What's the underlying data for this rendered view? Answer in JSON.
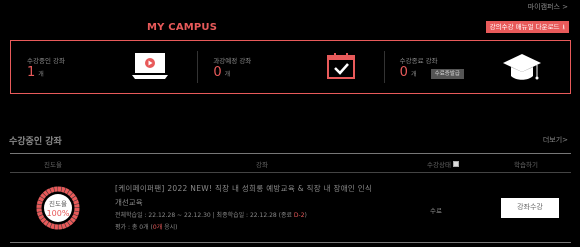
{
  "breadcrumb": "마이캠퍼스 >",
  "page_title": "MY CAMPUS",
  "manual_button": "강의수강 매뉴얼 다운로드",
  "colors": {
    "accent": "#e85a5a",
    "background": "#000000"
  },
  "stats": [
    {
      "label": "수강중인 강좌",
      "value": "1",
      "unit": "개",
      "icon": "laptop-play-icon"
    },
    {
      "label": "과강예정 강좌",
      "value": "0",
      "unit": "개",
      "icon": "calendar-check-icon"
    },
    {
      "label": "수강종료 강좌",
      "value": "0",
      "unit": "개",
      "button": "수료증발급",
      "icon": "graduation-cap-icon"
    }
  ],
  "section": {
    "title": "수강중인 강좌",
    "more": "더보기>"
  },
  "table": {
    "headers": {
      "progress": "진도율",
      "course": "강좌",
      "review": "수강상태",
      "study": "학습하기"
    },
    "rows": [
      {
        "progress_label": "진도율",
        "progress_pct": "100%",
        "progress_value": 1.0,
        "title": "[케이페이퍼팬] 2022 NEW! 직장 내 성희롱 예방교육 & 직장 내 장애인 인식",
        "subtitle": "개선교육",
        "period_prefix": "전체학습일 : 22.12.28 ~ 22.12.30 | 최종학습일 : 22.12.28 (종료",
        "period_dday": "D-2",
        "period_suffix": ")",
        "eval_prefix": "평가 : 총 0개 (",
        "eval_highlight": "0개",
        "eval_suffix": " 응시)",
        "status": "수료",
        "study_button": "강좌수강"
      }
    ]
  }
}
